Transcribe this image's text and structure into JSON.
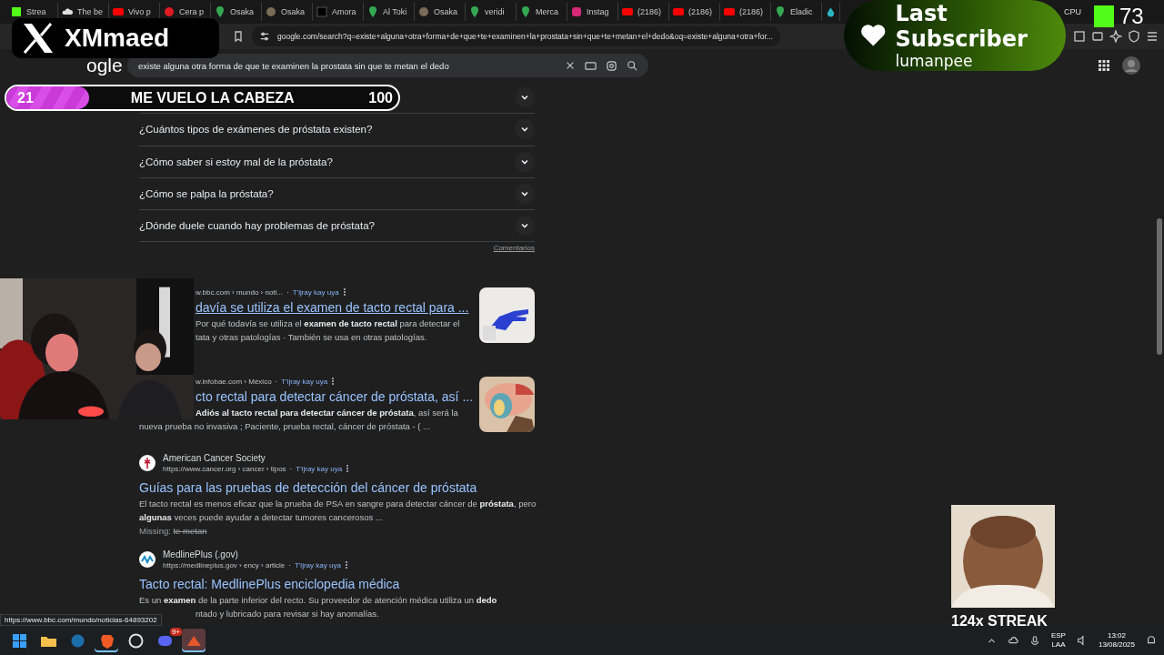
{
  "tabs": [
    {
      "kind": "kick",
      "label": "Strea"
    },
    {
      "kind": "cloud",
      "label": "The be"
    },
    {
      "kind": "youtube",
      "label": "Vivo p"
    },
    {
      "kind": "red",
      "label": "Cera p"
    },
    {
      "kind": "maps",
      "label": "Osaka"
    },
    {
      "kind": "globe",
      "label": "Osaka"
    },
    {
      "kind": "dark",
      "label": "Amora"
    },
    {
      "kind": "maps",
      "label": "Al Toki"
    },
    {
      "kind": "globe",
      "label": "Osaka"
    },
    {
      "kind": "maps",
      "label": "veridi"
    },
    {
      "kind": "maps",
      "label": "Merca"
    },
    {
      "kind": "instagram",
      "label": "Instag"
    },
    {
      "kind": "youtube",
      "label": "(2186)"
    },
    {
      "kind": "youtube",
      "label": "(2186)"
    },
    {
      "kind": "youtube",
      "label": "(2186)"
    },
    {
      "kind": "maps",
      "label": "Eladic"
    },
    {
      "kind": "drop"
    }
  ],
  "system_monitor": {
    "label": "CPU"
  },
  "address_bar": {
    "url": "google.com/search?q=existe+alguna+otra+forma+de+que+te+examinen+la+prostata+sin+que+te+metan+el+dedo&oq=existe+alguna+otra+for..."
  },
  "google": {
    "logo": "ogle",
    "query": "existe alguna otra forma de que te examinen la prostata sin que te metan el dedo"
  },
  "faq": {
    "questions": [
      {
        "expanded": false
      },
      {
        "text": "¿Cuántos tipos de exámenes de próstata existen?",
        "expanded": false
      },
      {
        "text": "¿Cómo saber si estoy mal de la próstata?",
        "expanded": false
      },
      {
        "text": "¿Cómo se palpa la próstata?",
        "expanded": false
      },
      {
        "text": "¿Dónde duele cuando hay problemas de próstata?",
        "expanded": false
      }
    ],
    "feedback": "Comentarios"
  },
  "results": [
    {
      "covered": true,
      "url": "w.bbc.com › mundo › noti...",
      "separator": "·",
      "translate": "T'ijray kay uya",
      "title": "davía se utiliza el examen de tacto rectal para ...",
      "hovered": true,
      "snippet": [
        {
          "text": "Por qué todavía se utiliza el **examen de tacto rectal** para detectar el",
          "covered": true
        },
        {
          "text": "tata y otras patologías · También se usa en otras patologías.",
          "covered": true
        }
      ]
    },
    {
      "covered": true,
      "url": "w.infobae.com › México",
      "separator": "·",
      "translate": "T'ijray kay uya",
      "title": "cto rectal para detectar cáncer de próstata, así ...",
      "hovered": false,
      "snippet": [
        {
          "text": "**Adiós al tacto rectal para detectar cáncer de próstata**, así será la",
          "covered": true
        },
        {
          "text": "nueva prueba no invasiva ; Paciente, prueba rectal, cáncer de próstata - ( ..."
        }
      ]
    },
    {
      "site": "American Cancer Society",
      "favicon": {
        "kind": "caduceus"
      },
      "url": "https://www.cancer.org › cancer › tipos",
      "separator": "·",
      "translate": "T'ijray kay uya",
      "title": "Guías para las pruebas de detección del cáncer de próstata",
      "hovered": false,
      "snippet": [
        {
          "text": "El tacto rectal es menos eficaz que la prueba de PSA en sangre para detectar cáncer de **próstata**, pero"
        },
        {
          "text": "**algunas** veces puede ayudar a detectar tumores cancerosos ..."
        }
      ],
      "missing": {
        "label": "Missing:",
        "terms": "te metan"
      }
    },
    {
      "site": "MedlinePlus (.gov)",
      "favicon": {
        "kind": "wave"
      },
      "url": "https://medlineplus.gov › ency › article",
      "separator": "·",
      "translate": "T'ijray kay uya",
      "title": "Tacto rectal: MedlinePlus enciclopedia médica",
      "hovered": false,
      "snippet": [
        {
          "text": "Es un **examen** de la parte inferior del recto. Su proveedor de atención médica utiliza un **dedo**"
        },
        {
          "text": "ntado y lubricado para revisar si hay anomalías.",
          "covered": true
        }
      ]
    }
  ],
  "status_url": "https://www.bbc.com/mundo/noticias-64893202",
  "overlays": {
    "channel": {
      "name": "XMmaed"
    },
    "subscriber": {
      "title": "Last Subscriber",
      "name": "lumanpee"
    },
    "viewer_count": "73",
    "goal": {
      "current": "21",
      "title": "ME VUELO LA CABEZA",
      "target": "100",
      "level": 0.21
    },
    "streak": {
      "label": "124x STREAK"
    }
  },
  "taskbar": {
    "apps": [
      {
        "kind": "start",
        "running": false,
        "selected": false
      },
      {
        "kind": "folder",
        "running": false,
        "selected": false
      },
      {
        "kind": "steam",
        "running": false,
        "selected": false
      },
      {
        "kind": "brave",
        "running": true,
        "selected": false
      },
      {
        "kind": "gauge",
        "running": false,
        "selected": false
      },
      {
        "kind": "discord",
        "running": false,
        "selected": false,
        "badge": "9+"
      },
      {
        "kind": "game",
        "running": true,
        "selected": true
      }
    ],
    "language": [
      "ESP",
      "LAA"
    ],
    "time": "13:02",
    "date": "13/08/2025"
  }
}
